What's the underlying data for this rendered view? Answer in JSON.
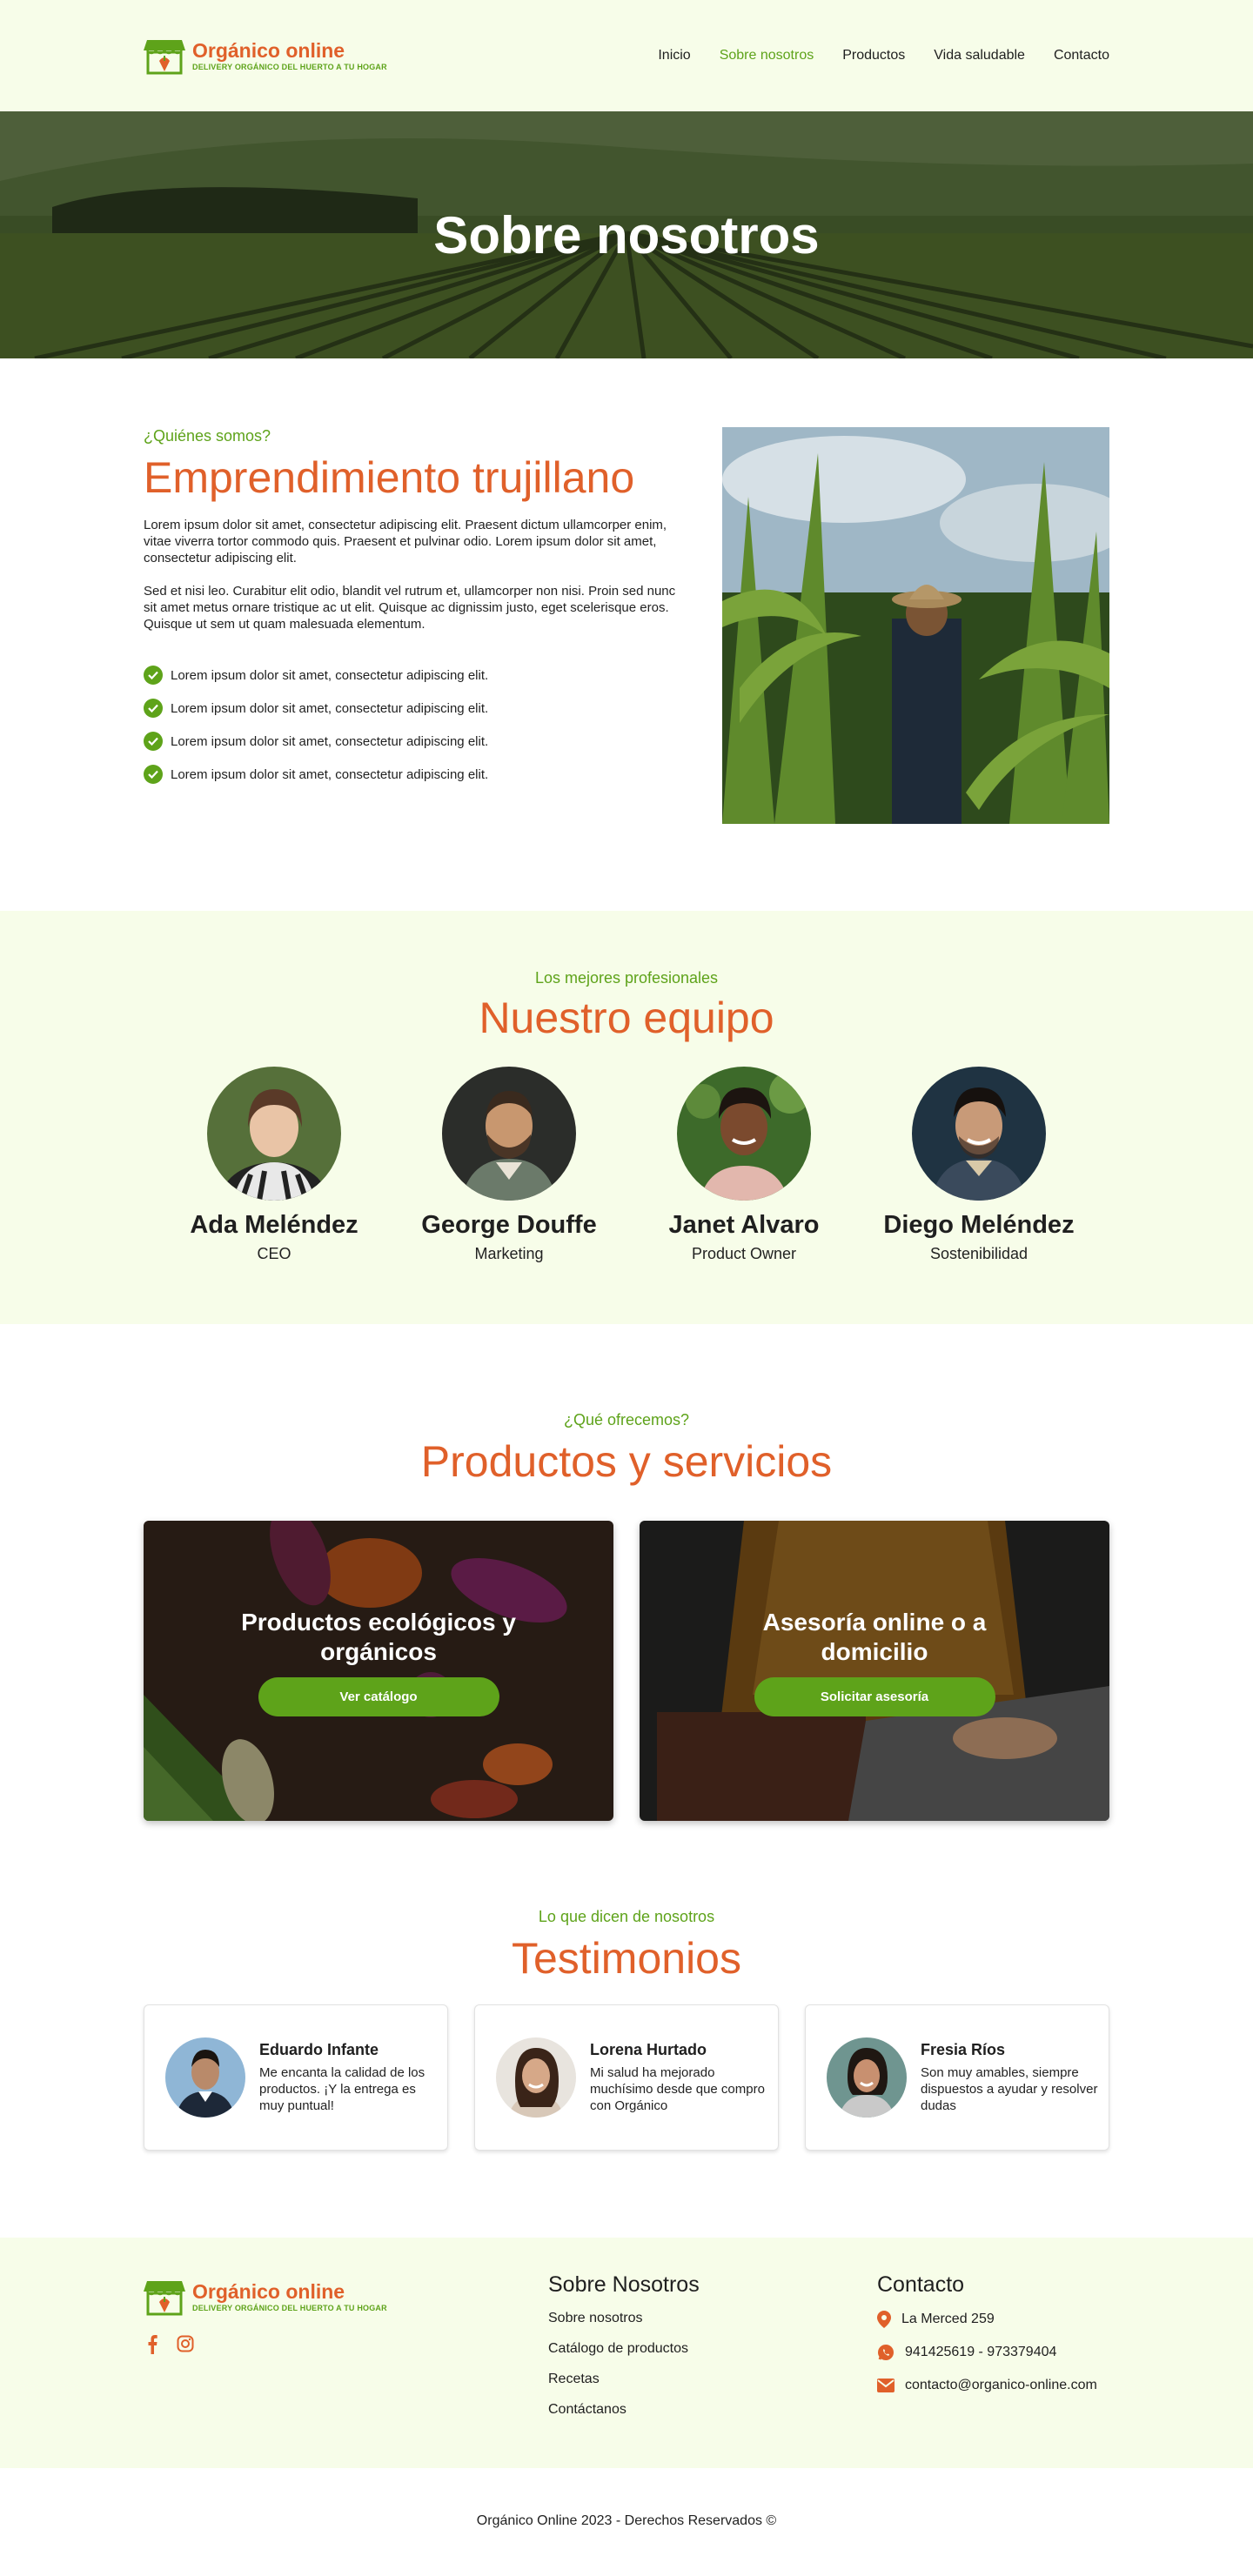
{
  "brand": {
    "name": "Orgánico online",
    "tagline": "DELIVERY ORGÁNICO DEL HUERTO A TU HOGAR",
    "green": "#5ea31a",
    "orange": "#e0602a",
    "light_bg": "#f7fde9"
  },
  "nav": {
    "items": [
      {
        "label": "Inicio",
        "active": false
      },
      {
        "label": "Sobre nosotros",
        "active": true
      },
      {
        "label": "Productos",
        "active": false
      },
      {
        "label": "Vida saludable",
        "active": false
      },
      {
        "label": "Contacto",
        "active": false
      }
    ]
  },
  "hero": {
    "title": "Sobre nosotros"
  },
  "about": {
    "kicker": "¿Quiénes somos?",
    "title": "Emprendimiento trujillano",
    "paragraphs": [
      "Lorem ipsum dolor sit amet, consectetur adipiscing elit. Praesent dictum ullamcorper enim, vitae viverra tortor commodo quis. Praesent et pulvinar odio. Lorem ipsum dolor sit amet, consectetur adipiscing elit.",
      "Sed et nisi leo. Curabitur elit odio, blandit vel rutrum et, ullamcorper non nisi. Proin sed nunc sit amet metus ornare tristique ac ut elit. Quisque ac dignissim justo, eget scelerisque eros. Quisque ut sem ut quam malesuada elementum."
    ],
    "checks": [
      "Lorem ipsum dolor sit amet, consectetur adipiscing elit.",
      "Lorem ipsum dolor sit amet, consectetur adipiscing elit.",
      "Lorem ipsum dolor sit amet, consectetur adipiscing elit.",
      "Lorem ipsum dolor sit amet, consectetur adipiscing elit."
    ]
  },
  "team": {
    "kicker": "Los mejores profesionales",
    "title": "Nuestro equipo",
    "members": [
      {
        "name": "Ada Meléndez",
        "role": "CEO"
      },
      {
        "name": "George Douffe",
        "role": "Marketing"
      },
      {
        "name": "Janet Alvaro",
        "role": "Product Owner"
      },
      {
        "name": "Diego Meléndez",
        "role": "Sostenibilidad"
      }
    ]
  },
  "products": {
    "kicker": "¿Qué ofrecemos?",
    "title": "Productos y servicios",
    "cards": [
      {
        "title": "Productos ecológicos y orgánicos",
        "button": "Ver catálogo"
      },
      {
        "title": "Asesoría online o a domicilio",
        "button": "Solicitar asesoría"
      }
    ]
  },
  "testimonials": {
    "kicker": "Lo que dicen de nosotros",
    "title": "Testimonios",
    "items": [
      {
        "name": "Eduardo Infante",
        "text": "Me encanta la calidad de los productos. ¡Y la entrega es muy puntual!"
      },
      {
        "name": "Lorena Hurtado",
        "text": "Mi salud ha mejorado muchísimo desde que compro con Orgánico"
      },
      {
        "name": "Fresia Ríos",
        "text": "Son muy amables, siempre dispuestos a ayudar y resolver dudas"
      }
    ]
  },
  "footer": {
    "about_title": "Sobre Nosotros",
    "about_links": [
      "Sobre nosotros",
      "Catálogo de productos",
      "Recetas",
      "Contáctanos"
    ],
    "contact_title": "Contacto",
    "address": "La Merced 259",
    "phones": "941425619 - 973379404",
    "email": "contacto@organico-online.com",
    "socials": [
      "facebook-icon",
      "instagram-icon"
    ],
    "copyright": "Orgánico Online 2023 - Derechos Reservados ©"
  }
}
